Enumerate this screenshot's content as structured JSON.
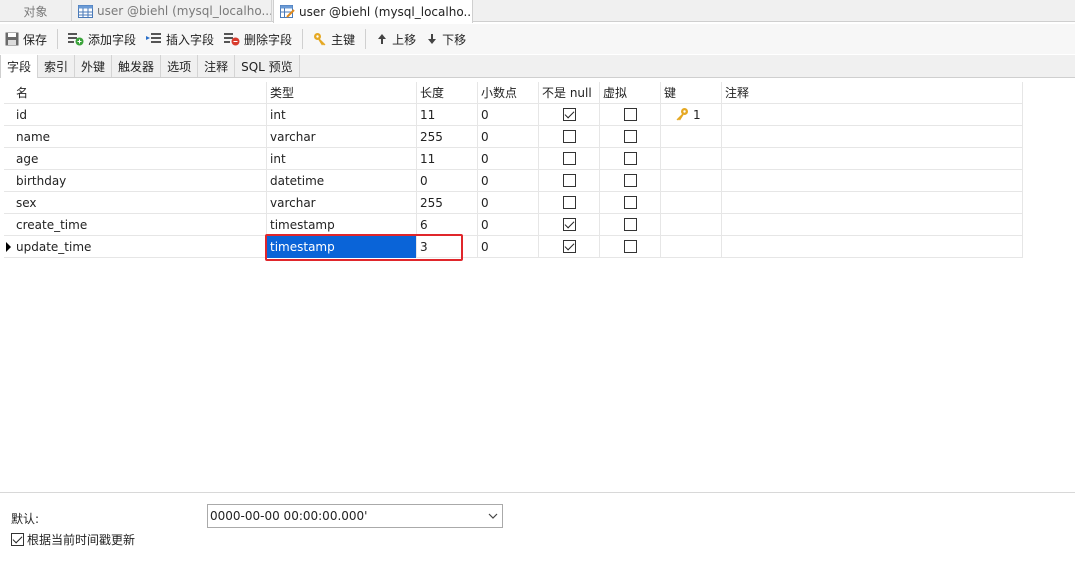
{
  "window_tabs": {
    "objects": "对象",
    "tab1": "user @biehl (mysql_localho...",
    "tab2": "user @biehl (mysql_localho..."
  },
  "toolbar": {
    "save": "保存",
    "add_field": "添加字段",
    "insert_field": "插入字段",
    "delete_field": "删除字段",
    "primary_key": "主键",
    "move_up": "上移",
    "move_down": "下移"
  },
  "sub_tabs": [
    "字段",
    "索引",
    "外键",
    "触发器",
    "选项",
    "注释",
    "SQL 预览"
  ],
  "grid": {
    "headers": [
      "名",
      "类型",
      "长度",
      "小数点",
      "不是 null",
      "虚拟",
      "键",
      "注释"
    ],
    "rows": [
      {
        "name": "id",
        "type": "int",
        "length": "11",
        "decimals": "0",
        "not_null": true,
        "virtual": false,
        "key": "1"
      },
      {
        "name": "name",
        "type": "varchar",
        "length": "255",
        "decimals": "0",
        "not_null": false,
        "virtual": false,
        "key": ""
      },
      {
        "name": "age",
        "type": "int",
        "length": "11",
        "decimals": "0",
        "not_null": false,
        "virtual": false,
        "key": ""
      },
      {
        "name": "birthday",
        "type": "datetime",
        "length": "0",
        "decimals": "0",
        "not_null": false,
        "virtual": false,
        "key": ""
      },
      {
        "name": "sex",
        "type": "varchar",
        "length": "255",
        "decimals": "0",
        "not_null": false,
        "virtual": false,
        "key": ""
      },
      {
        "name": "create_time",
        "type": "timestamp",
        "length": "6",
        "decimals": "0",
        "not_null": true,
        "virtual": false,
        "key": ""
      },
      {
        "name": "update_time",
        "type": "timestamp",
        "length": "3",
        "decimals": "0",
        "not_null": true,
        "virtual": false,
        "key": ""
      }
    ]
  },
  "bottom": {
    "default_label": "默认:",
    "default_value": "0000-00-00 00:00:00.000'",
    "update_checkbox_label": "根据当前时间戳更新"
  },
  "colors": {
    "selection": "#0a64d8",
    "highlight_box": "#e0262b"
  }
}
